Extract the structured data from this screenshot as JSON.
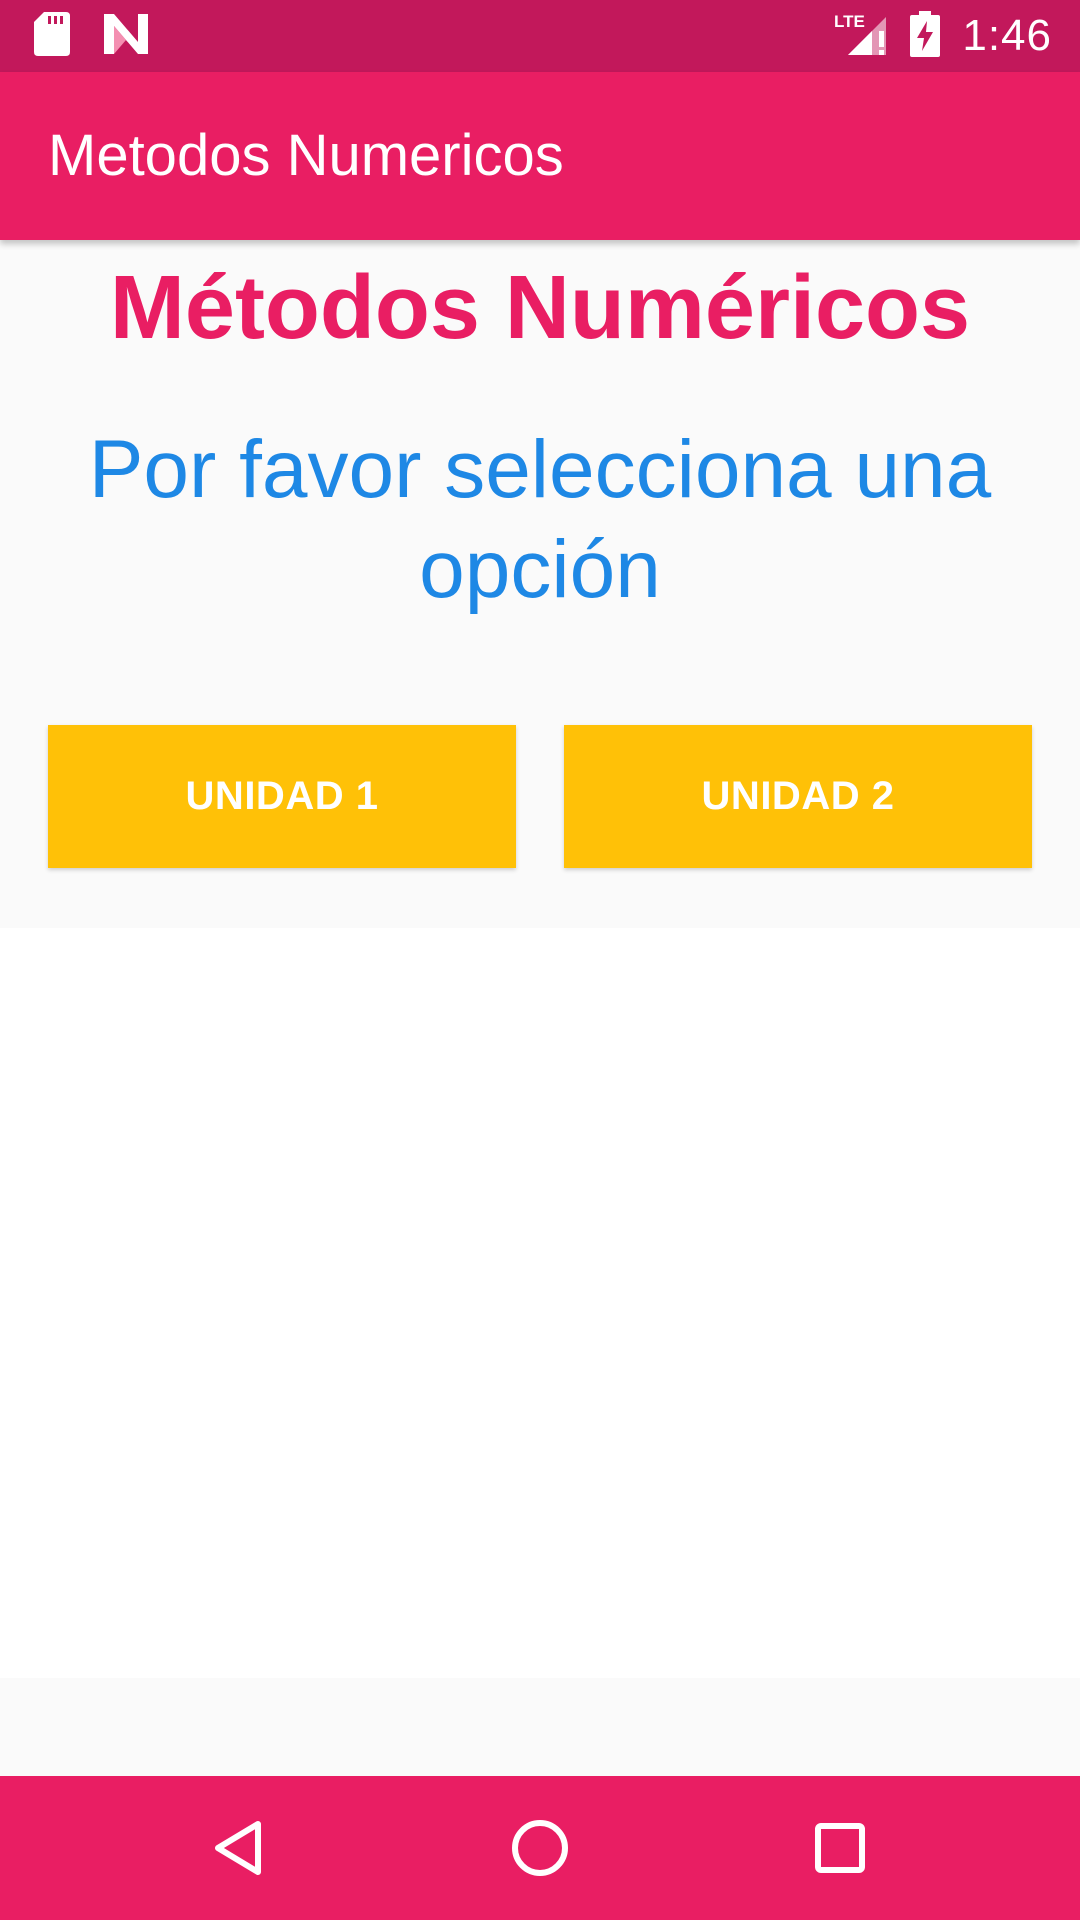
{
  "status_bar": {
    "time": "1:46",
    "network_label": "LTE",
    "icons": [
      "sd-card-icon",
      "n-logo-icon",
      "signal-icon",
      "battery-charging-icon"
    ]
  },
  "app_bar": {
    "title": "Metodos Numericos"
  },
  "main": {
    "heading": "Métodos Numéricos",
    "prompt": "Por favor selecciona una opción",
    "buttons": [
      {
        "label": "UNIDAD 1"
      },
      {
        "label": "UNIDAD 2"
      }
    ]
  },
  "nav_bar": {
    "icons": [
      "back-icon",
      "home-icon",
      "recent-apps-icon"
    ]
  },
  "colors": {
    "status_bar": "#c2185b",
    "primary": "#e91e63",
    "heading": "#e91e63",
    "prompt": "#1e88e5",
    "button": "#ffc107",
    "button_text": "#ffffff",
    "content_background": "#fafafa"
  }
}
